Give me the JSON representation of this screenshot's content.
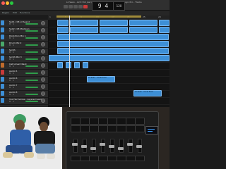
{
  "window": {
    "title": "Lil Sean - Ain't Hot Just (feat. Daz Dillinger) (c) 1-ish - Logic Pro - Tracks"
  },
  "toolbar": {
    "lcd_bars": "9 4",
    "tempo": "120"
  },
  "track_header": {
    "region_label": "Region",
    "edit_label": "Edit",
    "functions_label": "Functions"
  },
  "ruler": {
    "marks": [
      "1",
      "5",
      "9",
      "13",
      "17",
      "21",
      "25",
      "29"
    ]
  },
  "tracks": [
    {
      "name": "Sp01 / 08 Lil Seand",
      "color": "#3d8fd6"
    },
    {
      "name": "Sp02 / 08 Mixdown",
      "color": "#3d8fd6"
    },
    {
      "name": "Distortion Mix 1",
      "color": "#3d8fd6"
    },
    {
      "name": "Drum Mix 2",
      "color": "#4aa96a"
    },
    {
      "name": "Synth",
      "color": "#3d8fd6"
    },
    {
      "name": "Synth Mix 3",
      "color": "#3d8fd6"
    },
    {
      "name": "Instrument Rack",
      "color": "#c06b2c"
    },
    {
      "name": "Audio 5",
      "color": "#c83a3a"
    },
    {
      "name": "Audio 6",
      "color": "#3d8fd6"
    },
    {
      "name": "Audio 7",
      "color": "#3d8fd6"
    },
    {
      "name": "Audio 8",
      "color": "#3d8fd6"
    },
    {
      "name": "Vox Harmonies - Layered Lead",
      "color": "#3d8fd6"
    }
  ],
  "track_buttons": {
    "mute": "M",
    "solo": "S"
  },
  "regions": {
    "vocal_a": "Lil Sean - Vocal Final",
    "vocal_b": "Lil Sean - Vocal Final"
  },
  "colors": {
    "region_blue": "#3d8fd6",
    "region_green": "#4aa96a",
    "fader_green": "#2f9c4a",
    "record_red": "#c83a3a"
  }
}
